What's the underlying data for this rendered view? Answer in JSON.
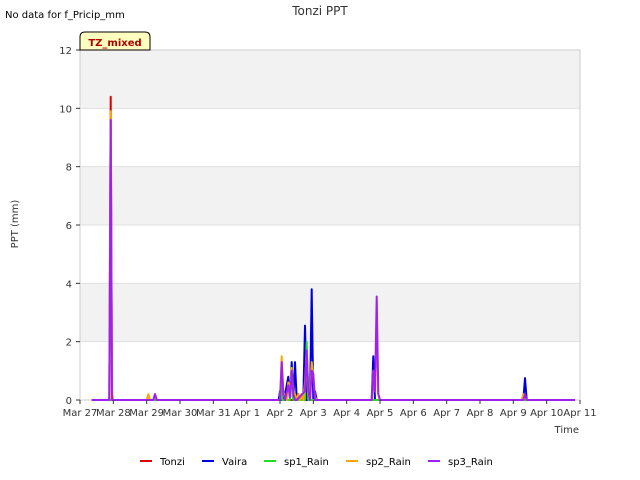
{
  "note": "No data for f_Pricip_mm",
  "chart_data": {
    "type": "line",
    "title": "Tonzi PPT",
    "xlabel": "Time",
    "ylabel": "PPT (mm)",
    "ylim": [
      0,
      12
    ],
    "yticks": [
      0,
      2,
      4,
      6,
      8,
      10,
      12
    ],
    "xlim": [
      0,
      15
    ],
    "x_unit": "days since Mar 27",
    "xtick_labels": [
      "Mar 27",
      "Mar 28",
      "Mar 29",
      "Mar 30",
      "Mar 31",
      "Apr 1",
      "Apr 2",
      "Apr 3",
      "Apr 4",
      "Apr 5",
      "Apr 6",
      "Apr 7",
      "Apr 8",
      "Apr 9",
      "Apr 10",
      "Apr 11"
    ],
    "grid": "horizontal bands",
    "tag": "TZ_mixed",
    "legend_position": "bottom",
    "series": [
      {
        "name": "Tonzi",
        "color": "#dd0000",
        "x": [
          0.35,
          0.88,
          0.92,
          0.96,
          1.0,
          13.25,
          13.35,
          13.4,
          14.85
        ],
        "y": [
          0,
          0,
          10.4,
          0.2,
          0,
          0,
          0.2,
          0,
          0
        ]
      },
      {
        "name": "Vaira",
        "color": "#0000dd",
        "x": [
          0.35,
          5.96,
          6.0,
          6.04,
          6.08,
          6.12,
          6.25,
          6.3,
          6.35,
          6.4,
          6.45,
          6.5,
          6.55,
          6.6,
          6.65,
          6.7,
          6.75,
          6.8,
          6.85,
          6.9,
          6.95,
          7.0,
          7.05,
          7.1,
          7.15,
          7.2,
          8.75,
          8.8,
          8.85,
          8.9,
          13.3,
          13.35,
          13.4,
          14.85
        ],
        "y": [
          0,
          0,
          0.3,
          0,
          0.3,
          0,
          0.8,
          0,
          1.3,
          0,
          1.3,
          0,
          0.2,
          0,
          0,
          0,
          2.55,
          0,
          0,
          0,
          3.8,
          0,
          0.3,
          0,
          0,
          0,
          0,
          1.5,
          0,
          0,
          0,
          0.75,
          0,
          0
        ]
      },
      {
        "name": "sp1_Rain",
        "color": "#22dd22",
        "x": [
          0.35,
          6.0,
          6.03,
          6.07,
          6.3,
          6.35,
          6.4,
          6.75,
          6.8,
          6.85,
          14.85
        ],
        "y": [
          0,
          0,
          0.5,
          0,
          0,
          1.0,
          0,
          0,
          2.0,
          0,
          0
        ]
      },
      {
        "name": "sp2_Rain",
        "color": "#ffa500",
        "x": [
          0.35,
          0.88,
          0.92,
          0.96,
          1.0,
          2.0,
          2.05,
          2.1,
          2.2,
          2.25,
          2.3,
          6.0,
          6.05,
          6.1,
          6.15,
          6.2,
          6.25,
          6.3,
          6.35,
          6.4,
          6.45,
          6.5,
          6.55,
          6.6,
          6.65,
          6.7,
          6.75,
          6.8,
          6.85,
          6.9,
          6.95,
          7.0,
          7.05,
          7.1,
          7.15,
          8.75,
          8.8,
          8.85,
          8.9,
          8.95,
          9.0,
          13.25,
          13.3,
          13.35,
          13.4,
          14.85
        ],
        "y": [
          0,
          0,
          9.9,
          0.3,
          0,
          0,
          0.2,
          0,
          0,
          0.2,
          0,
          0,
          1.5,
          0.3,
          0.1,
          0,
          0.6,
          0.3,
          1.1,
          0.3,
          0.2,
          0,
          0.2,
          0,
          0.2,
          0,
          0.6,
          1.6,
          0.2,
          0,
          1.3,
          0.8,
          0.1,
          0,
          0,
          0,
          1.0,
          0.3,
          2.6,
          0.2,
          0,
          0,
          0.2,
          0.1,
          0,
          0
        ]
      },
      {
        "name": "sp3_Rain",
        "color": "#a020f0",
        "x": [
          0.35,
          0.88,
          0.92,
          0.96,
          1.0,
          2.2,
          2.25,
          2.3,
          6.0,
          6.05,
          6.1,
          6.15,
          6.25,
          6.3,
          6.35,
          6.4,
          6.45,
          6.5,
          6.75,
          6.8,
          6.85,
          6.9,
          6.95,
          7.0,
          7.05,
          8.75,
          8.8,
          8.85,
          8.9,
          8.95,
          9.0,
          13.3,
          13.35,
          13.4,
          14.85
        ],
        "y": [
          0,
          0,
          9.6,
          0,
          0,
          0,
          0.2,
          0,
          0,
          1.3,
          0.2,
          0,
          0.5,
          0.1,
          1.0,
          0.2,
          0,
          0,
          0.3,
          1.7,
          0.3,
          0,
          1.0,
          0.9,
          0,
          0,
          1.0,
          0.3,
          3.55,
          0.2,
          0,
          0,
          0.2,
          0,
          0
        ]
      }
    ]
  }
}
